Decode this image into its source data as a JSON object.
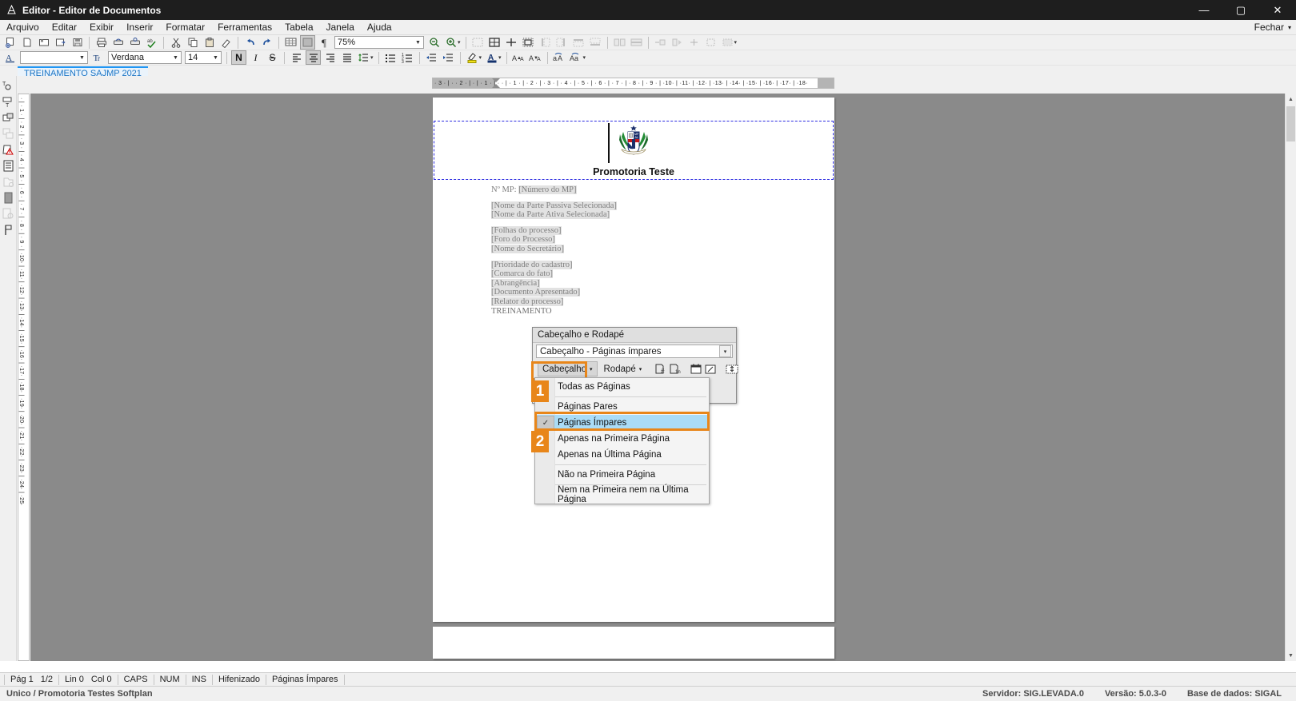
{
  "window": {
    "title": "Editor - Editor de Documentos",
    "app_icon": "document-editor-icon",
    "minimize": "—",
    "maximize": "▢",
    "close": "✕"
  },
  "menubar": {
    "items": [
      {
        "label": "Arquivo",
        "accel": "A"
      },
      {
        "label": "Editar",
        "accel": "E"
      },
      {
        "label": "Exibir",
        "accel": "x"
      },
      {
        "label": "Inserir",
        "accel": "I"
      },
      {
        "label": "Formatar",
        "accel": "F"
      },
      {
        "label": "Ferramentas",
        "accel": "m"
      },
      {
        "label": "Tabela",
        "accel": "b"
      },
      {
        "label": "Janela",
        "accel": "J"
      },
      {
        "label": "Ajuda",
        "accel": "u"
      }
    ],
    "close_label": "Fechar",
    "close_caret": "▾"
  },
  "toolbar1": {
    "zoom_value": "75%",
    "icons": [
      "new-document-icon",
      "open-folder-icon",
      "save-as-icon",
      "save-copy-icon",
      "save-icon",
      "print-icon",
      "print-preview-icon",
      "print-setup-icon",
      "spellcheck-icon",
      "cut-icon",
      "copy-icon",
      "paste-icon",
      "format-painter-icon",
      "undo-icon",
      "redo-icon",
      "table-grid-icon",
      "shading-icon",
      "paragraph-marks-icon"
    ],
    "zoom_out_icon": "zoom-out-icon",
    "zoom_in_icon": "zoom-in-icon",
    "overflow_icon": "toolbar-overflow-icon",
    "table_icons": [
      "insert-table-icon",
      "table-borders-icon",
      "insert-cell-icon",
      "merge-cell-icon",
      "split-cell-icon",
      "split-column-icon",
      "distribute-rows-icon",
      "distribute-cols-icon",
      "row-insert-icon",
      "column-insert-icon",
      "cell-align-icon",
      "text-direction-icon",
      "table-props-icon"
    ]
  },
  "toolbar2": {
    "style_value": "",
    "font_value": "Verdana",
    "size_value": "14",
    "bold_label": "N",
    "italic_label": "I",
    "underline_label": "S",
    "icons": [
      "text-style-icon",
      "align-left-icon",
      "align-center-icon",
      "align-right-icon",
      "align-justify-icon",
      "line-spacing-icon",
      "bullet-list-icon",
      "number-list-icon",
      "decrease-indent-icon",
      "increase-indent-icon",
      "highlight-color-icon",
      "font-color-icon",
      "grow-font-icon",
      "shrink-font-icon",
      "change-case-up-icon",
      "change-case-down-icon"
    ]
  },
  "tabstrip": {
    "active_tab": "TREINAMENTO SAJMP 2021"
  },
  "leftbar": {
    "icons": [
      "text-box-icon",
      "text-frame-icon",
      "duplicate-frame-icon",
      "copy-frame-icon",
      "warning-frame-icon",
      "document-properties-icon",
      "folder-frame-icon",
      "page-fill-icon",
      "seal-stamp-icon",
      "flag-marker-icon"
    ]
  },
  "ruler": {
    "horizontal": "· 3 · | · · 2 · | · | · 1 · | ·     · | · 1 · | · 2 · | · 3 · | · 4 · | · 5 · | · 6 · | · 7 · | · 8 · | · 9 · | ·10· | ·11· | ·12· | ·13· | ·14· | ·15· | ·16· | ·17· | ·18·",
    "vertical": "· | · 1 · | · 2 · | · 3 · | · 4 · | · 5 · | · 6 · | · 7 · | · 8 · | · 9 · | ·10· | ·11· | ·12· | ·13· | ·14· | ·15· | ·16· | ·17· | ·18· | ·19· | ·20· | ·21· | ·22· | ·23· | ·24· | ·25·"
  },
  "document": {
    "header_title": "Promotoria Teste",
    "crest_alt": "mp-al-coat-of-arms",
    "crest_text": "MP\nAL",
    "lines": [
      {
        "prefix": "Nº MP: ",
        "field": "[Número do MP]"
      },
      {
        "gap": true
      },
      {
        "field": "[Nome da Parte Passiva Selecionada]"
      },
      {
        "field": "[Nome da Parte Ativa Selecionada]"
      },
      {
        "gap": true
      },
      {
        "field": "[Folhas do processo]"
      },
      {
        "field": "[Foro do Processo]"
      },
      {
        "field": "[Nome do Secretário]"
      },
      {
        "gap": true
      },
      {
        "field": "[Prioridade do cadastro]"
      },
      {
        "field": "[Comarca do fato]"
      },
      {
        "field": "[Abrangência]"
      },
      {
        "field": "[Documento Apresentado]"
      },
      {
        "field": "[Relator do processo]"
      },
      {
        "plain": "TREINAMENTO"
      }
    ]
  },
  "hf_dialog": {
    "title": "Cabeçalho e Rodapé",
    "current_selection": "Cabeçalho -  Páginas ímpares",
    "combo_arrow": "▾",
    "header_button": "Cabeçalho",
    "footer_button": "Rodapé",
    "button_caret": "▾",
    "tool_icons": [
      "page-number-icon",
      "page-count-icon",
      "insert-date-icon",
      "insert-time-icon",
      "page-setup-icon"
    ]
  },
  "dropdown": {
    "items": [
      {
        "label": "Todas as Páginas",
        "checked": false,
        "selected": false
      },
      {
        "divider_after": true
      },
      {
        "label": "Páginas Pares",
        "checked": false,
        "selected": false
      },
      {
        "label": "Páginas Ímpares",
        "checked": true,
        "selected": true
      },
      {
        "label": "Apenas na Primeira Página",
        "checked": false,
        "selected": false
      },
      {
        "label": "Apenas na Última Página",
        "checked": false,
        "selected": false
      },
      {
        "divider_after": true
      },
      {
        "label": "Não na Primeira Página",
        "checked": false,
        "selected": false
      },
      {
        "divider_after": true
      },
      {
        "label": "Nem na Primeira nem na Última Página",
        "checked": false,
        "selected": false
      }
    ],
    "check_glyph": "✓"
  },
  "badges": [
    {
      "number": "1"
    },
    {
      "number": "2"
    }
  ],
  "statusbar": {
    "page": "Pág 1",
    "page_total": "1/2",
    "line": "Lin 0",
    "col": "Col 0",
    "caps": "CAPS",
    "num": "NUM",
    "ins": "INS",
    "hyphen": "Hifenizado",
    "mode": "Páginas Ímpares"
  },
  "bottombar": {
    "left": "Unico / Promotoria Testes Softplan",
    "server": "Servidor: SIG.LEVADA.0",
    "version": "Versão: 5.0.3-0",
    "database": "Base de dados: SIGAL"
  },
  "colors": {
    "accent_orange": "#e8861a",
    "selection_blue": "#aadcf7",
    "tab_blue": "#1b74c4",
    "titlebar": "#1e1e1e",
    "canvas_grey": "#8a8a8a"
  }
}
